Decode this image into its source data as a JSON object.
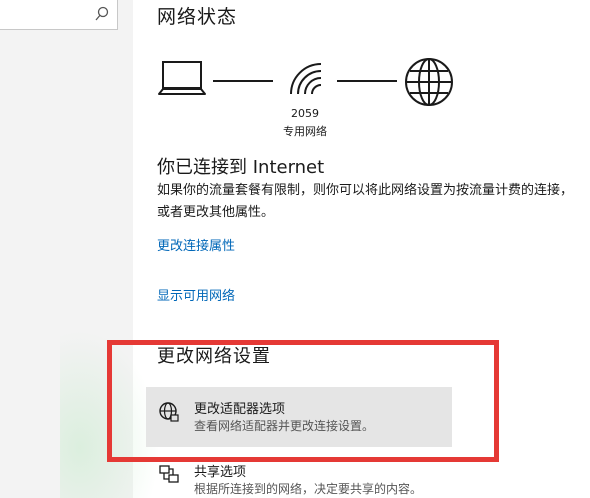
{
  "search": {
    "icon": "search-icon"
  },
  "status": {
    "section_title": "网络状态",
    "network_name": "2059",
    "network_type": "专用网络",
    "icons": [
      "laptop-icon",
      "wifi-icon",
      "globe-icon"
    ],
    "connected_title": "你已连接到 Internet",
    "description": "如果你的流量套餐有限制，则你可以将此网络设置为按流量计费的连接，或者更改其他属性。",
    "link_properties": "更改连接属性",
    "link_available": "显示可用网络"
  },
  "change_settings": {
    "section_title": "更改网络设置",
    "options": [
      {
        "icon": "adapter-globe-icon",
        "title": "更改适配器选项",
        "subtitle": "查看网络适配器并更改连接设置。"
      },
      {
        "icon": "sharing-icon",
        "title": "共享选项",
        "subtitle": "根据所连接到的网络，决定要共享的内容。"
      }
    ]
  },
  "colors": {
    "link": "#0067b8",
    "highlight_bg": "#e5e5e5",
    "annotation_red": "#e53935",
    "nav_bg": "#f3f3f3"
  }
}
